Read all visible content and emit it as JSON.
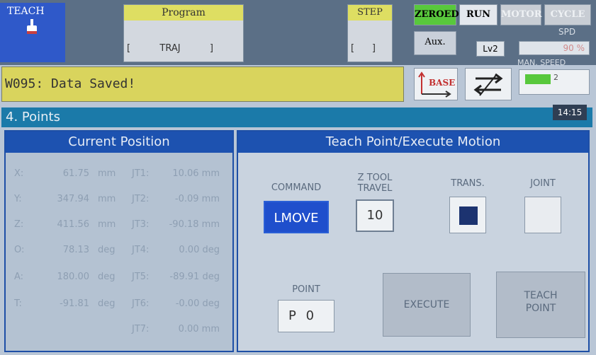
{
  "header": {
    "mode_label": "TEACH",
    "program_title": "Program",
    "program_value": "[          TRAJ          ]",
    "step_title": "STEP",
    "step_value": "[      ]",
    "status_buttons": [
      "ZEROED",
      "RUN",
      "MOTOR",
      "CYCLE"
    ],
    "status_colors": {
      "zeroed": "#58c83c",
      "run": "#e4e8ee",
      "motor": "#c8cdd4",
      "cycle": "#c8cdd4"
    },
    "aux_label": "Aux.",
    "level_label": "Lv2",
    "spd_label": "SPD",
    "spd_value": "90 %",
    "man_speed_label": "MAN. SPEED",
    "man_speed_value": "2",
    "base_label": "BASE"
  },
  "message": "W095: Data Saved!",
  "screen": {
    "title": "4. Points",
    "clock": "14:15"
  },
  "current_position": {
    "title": "Current Position",
    "rows": [
      {
        "axis": "X:",
        "value": "61.75",
        "unit": "mm",
        "jt": "JT1:",
        "jt_value": "10.06",
        "jt_unit": "mm"
      },
      {
        "axis": "Y:",
        "value": "347.94",
        "unit": "mm",
        "jt": "JT2:",
        "jt_value": "-0.09",
        "jt_unit": "mm"
      },
      {
        "axis": "Z:",
        "value": "411.56",
        "unit": "mm",
        "jt": "JT3:",
        "jt_value": "-90.18",
        "jt_unit": "mm"
      },
      {
        "axis": "O:",
        "value": "78.13",
        "unit": "deg",
        "jt": "JT4:",
        "jt_value": "0.00",
        "jt_unit": "deg"
      },
      {
        "axis": "A:",
        "value": "180.00",
        "unit": "deg",
        "jt": "JT5:",
        "jt_value": "-89.91",
        "jt_unit": "deg"
      },
      {
        "axis": "T:",
        "value": "-91.81",
        "unit": "deg",
        "jt": "JT6:",
        "jt_value": "-0.00",
        "jt_unit": "deg"
      },
      {
        "axis": "",
        "value": "",
        "unit": "",
        "jt": "JT7:",
        "jt_value": "0.00",
        "jt_unit": "mm"
      }
    ]
  },
  "teach_panel": {
    "title": "Teach Point/Execute Motion",
    "command_label": "COMMAND",
    "command_value": "LMOVE",
    "ztool_label_1": "Z TOOL",
    "ztool_label_2": "TRAVEL",
    "ztool_value": "10",
    "trans_label": "TRANS.",
    "joint_label": "JOINT",
    "point_label": "POINT",
    "point_value": "P 0",
    "execute_label": "EXECUTE",
    "teach_point_label_1": "TEACH",
    "teach_point_label_2": "POINT"
  }
}
